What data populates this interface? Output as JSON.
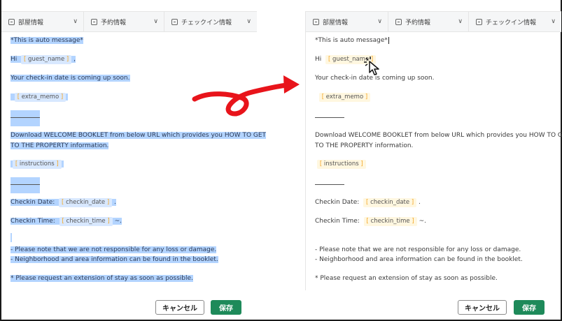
{
  "toolbar": {
    "room_info": "部屋情報",
    "reservation_info": "予約情報",
    "checkin_info": "チェックイン情報",
    "chevron": "∨"
  },
  "message": {
    "auto": "*This is auto message*",
    "hi": "Hi",
    "guest_name": "guest_name",
    "comma": ",",
    "upcoming": "Your check-in date is coming up soon.",
    "extra_memo": "extra_memo",
    "download_1": "Download WELCOME BOOKLET from below URL which provides you HOW TO GET",
    "download_2": "TO THE PROPERTY information.",
    "instructions": "instructions",
    "checkin_date_label": "Checkin Date:",
    "checkin_date": "checkin_date",
    "period": ".",
    "checkin_time_label": "Checkin Time:",
    "checkin_time": "checkin_time",
    "tilde": "~.",
    "note_1": "- Please note that we are not responsible for any loss or damage.",
    "note_2": "- Neighborhood and area information can be found in the booklet.",
    "note_3": "* Please request an extension of stay as soon as possible."
  },
  "buttons": {
    "cancel": "キャンセル",
    "save": "保存"
  },
  "token_brackets": {
    "open": "[",
    "close": "]"
  },
  "colors": {
    "save_button": "#1e8a5a",
    "selection": "#b3d4ff",
    "arrow": "#e8141b",
    "token_bg": "#fff7e0",
    "token_bracket": "#f5a623"
  },
  "icons": [
    "room-icon",
    "reservation-icon",
    "checkin-icon",
    "chevron-down-icon",
    "cursor-icon",
    "arrow-icon"
  ]
}
